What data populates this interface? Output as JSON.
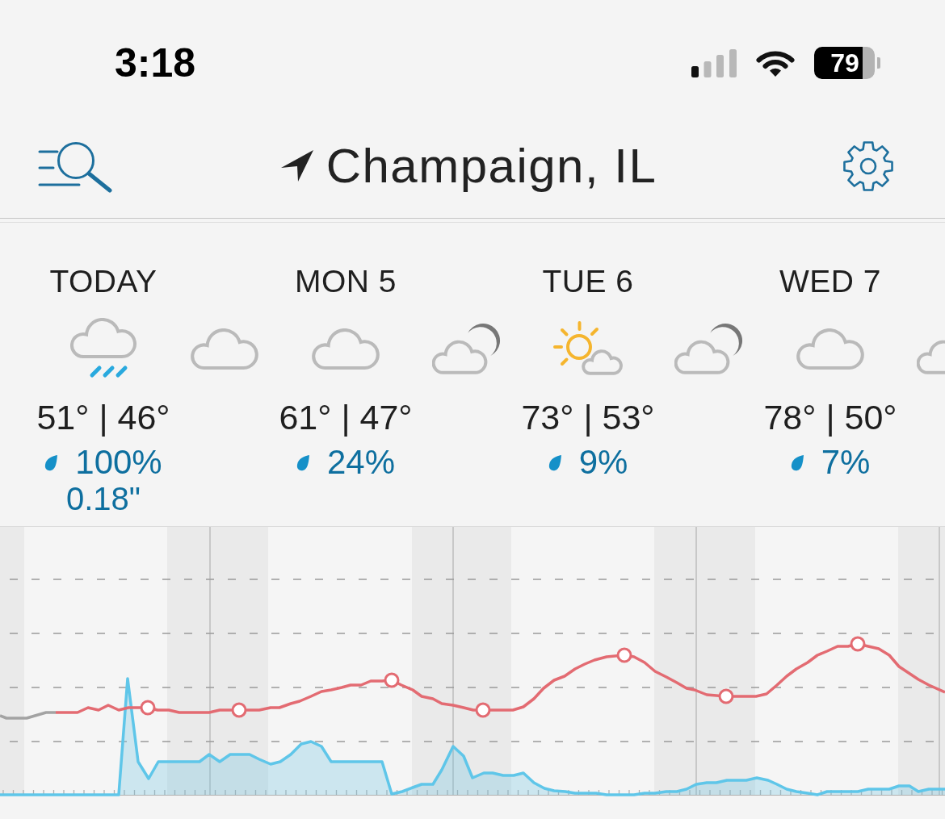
{
  "status_bar": {
    "time": "3:18",
    "battery_percent": "79"
  },
  "header": {
    "location": "Champaign, IL"
  },
  "days": [
    {
      "label": "TODAY",
      "day_icon": {
        "kind": "rain"
      },
      "night_icon": {
        "kind": "cloud"
      },
      "temperatures": "51° | 46°",
      "precip_chance": "100%",
      "precip_amount": "0.18\""
    },
    {
      "label": "MON 5",
      "day_icon": {
        "kind": "cloud"
      },
      "night_icon": {
        "kind": "cloud-moon"
      },
      "temperatures": "61° | 47°",
      "precip_chance": "24%"
    },
    {
      "label": "TUE 6",
      "day_icon": {
        "kind": "sun-cloud"
      },
      "night_icon": {
        "kind": "cloud-moon"
      },
      "temperatures": "73° | 53°",
      "precip_chance": "9%"
    },
    {
      "label": "WED 7",
      "day_icon": {
        "kind": "cloud"
      },
      "night_icon": {
        "kind": "cloud-moon"
      },
      "temperatures": "78° | 50°",
      "precip_chance": "7%"
    }
  ]
}
